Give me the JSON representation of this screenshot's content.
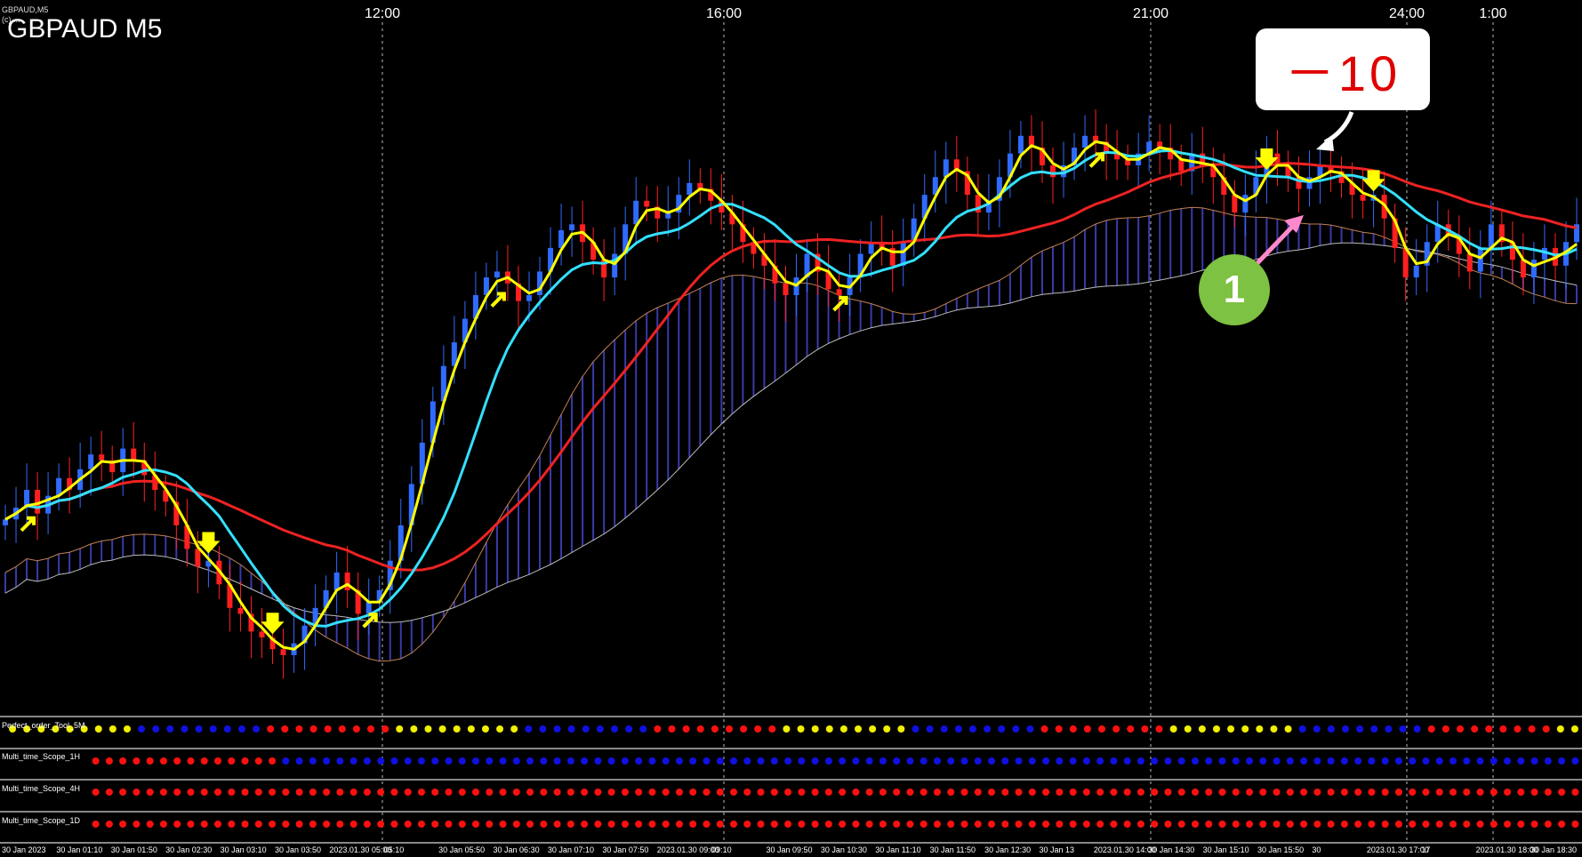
{
  "window": {
    "small_title": "GBPAUD,M5",
    "subtitle": "(c) ... ",
    "symbol_label": "GBPAUD M5"
  },
  "annotations": {
    "callout_text": "－10",
    "badge_text": "1"
  },
  "time_axis_top": [
    "12:00",
    "16:00",
    "21:00",
    "24:00",
    "1:00"
  ],
  "indicator_panels": [
    {
      "name": "Perfect_order_Tool_5M"
    },
    {
      "name": "Multi_time_Scope_1H"
    },
    {
      "name": "Multi_time_Scope_4H"
    },
    {
      "name": "Multi_time_Scope_1D"
    }
  ],
  "bottom_axis_labels": [
    "30 Jan 2023",
    "30 Jan 01:10",
    "30 Jan 01:50",
    "30 Jan 02:30",
    "30 Jan 03:10",
    "30 Jan 03:50",
    "2023.01.30 05:00",
    "05:10",
    "30 Jan 05:50",
    "30 Jan 06:30",
    "30 Jan 07:10",
    "30 Jan 07:50",
    "2023.01.30 09:00",
    "09:10",
    "30 Jan 09:50",
    "30 Jan 10:30",
    "30 Jan 11:10",
    "30 Jan 11:50",
    "30 Jan 12:30",
    "30 Jan 13",
    "2023.01.30 14:00",
    "30 Jan 14:30",
    "30 Jan 15:10",
    "30 Jan 15:50",
    "30",
    "2023.01.30 17:00",
    "17",
    "2023.01.30 18:00",
    "30 Jan 18:30"
  ],
  "colors": {
    "bull": "#2f6bff",
    "bear": "#ff1f1f",
    "ma_fast": "#ffff00",
    "ma_mid": "#33e0ff",
    "ma_slow": "#ee2222",
    "cloud": "#3a3aa8",
    "span": "#c08050",
    "dot_blue": "#1010e0",
    "dot_red": "#ff1010",
    "dot_yellow": "#f0f000",
    "badge": "#7dc242",
    "pink_arrow": "#ff88cc"
  },
  "chart_data": {
    "type": "candlestick",
    "title": "GBPAUD M5",
    "xlabel": "",
    "ylabel": "",
    "grid": "vertical dashed at session marks",
    "closes": [
      0.2,
      0.24,
      0.3,
      0.22,
      0.28,
      0.34,
      0.3,
      0.37,
      0.42,
      0.4,
      0.36,
      0.44,
      0.4,
      0.35,
      0.3,
      0.26,
      0.18,
      0.1,
      0.04,
      0.06,
      -0.02,
      -0.1,
      -0.12,
      -0.18,
      -0.2,
      -0.24,
      -0.26,
      -0.22,
      -0.16,
      -0.1,
      -0.04,
      0.02,
      -0.04,
      -0.12,
      -0.08,
      -0.04,
      0.06,
      0.18,
      0.32,
      0.46,
      0.6,
      0.72,
      0.8,
      0.88,
      0.96,
      1.02,
      1.04,
      1.0,
      0.94,
      0.96,
      1.04,
      1.12,
      1.18,
      1.2,
      1.14,
      1.08,
      1.02,
      1.1,
      1.2,
      1.28,
      1.26,
      1.22,
      1.24,
      1.3,
      1.34,
      1.32,
      1.28,
      1.24,
      1.2,
      1.14,
      1.1,
      1.06,
      1.0,
      0.96,
      1.02,
      1.1,
      1.04,
      0.98,
      0.96,
      1.02,
      1.1,
      1.14,
      1.12,
      1.06,
      1.14,
      1.22,
      1.3,
      1.36,
      1.42,
      1.38,
      1.3,
      1.24,
      1.28,
      1.36,
      1.44,
      1.5,
      1.46,
      1.4,
      1.36,
      1.4,
      1.46,
      1.5,
      1.48,
      1.44,
      1.42,
      1.4,
      1.44,
      1.48,
      1.46,
      1.42,
      1.38,
      1.44,
      1.4,
      1.36,
      1.3,
      1.24,
      1.3,
      1.36,
      1.44,
      1.4,
      1.36,
      1.32,
      1.36,
      1.4,
      1.38,
      1.34,
      1.3,
      1.28,
      1.3,
      1.22,
      1.12,
      1.02,
      1.06,
      1.14,
      1.2,
      1.16,
      1.1,
      1.04,
      1.12,
      1.2,
      1.14,
      1.08,
      1.02,
      1.08,
      1.12,
      1.06,
      1.14,
      1.2
    ]
  }
}
